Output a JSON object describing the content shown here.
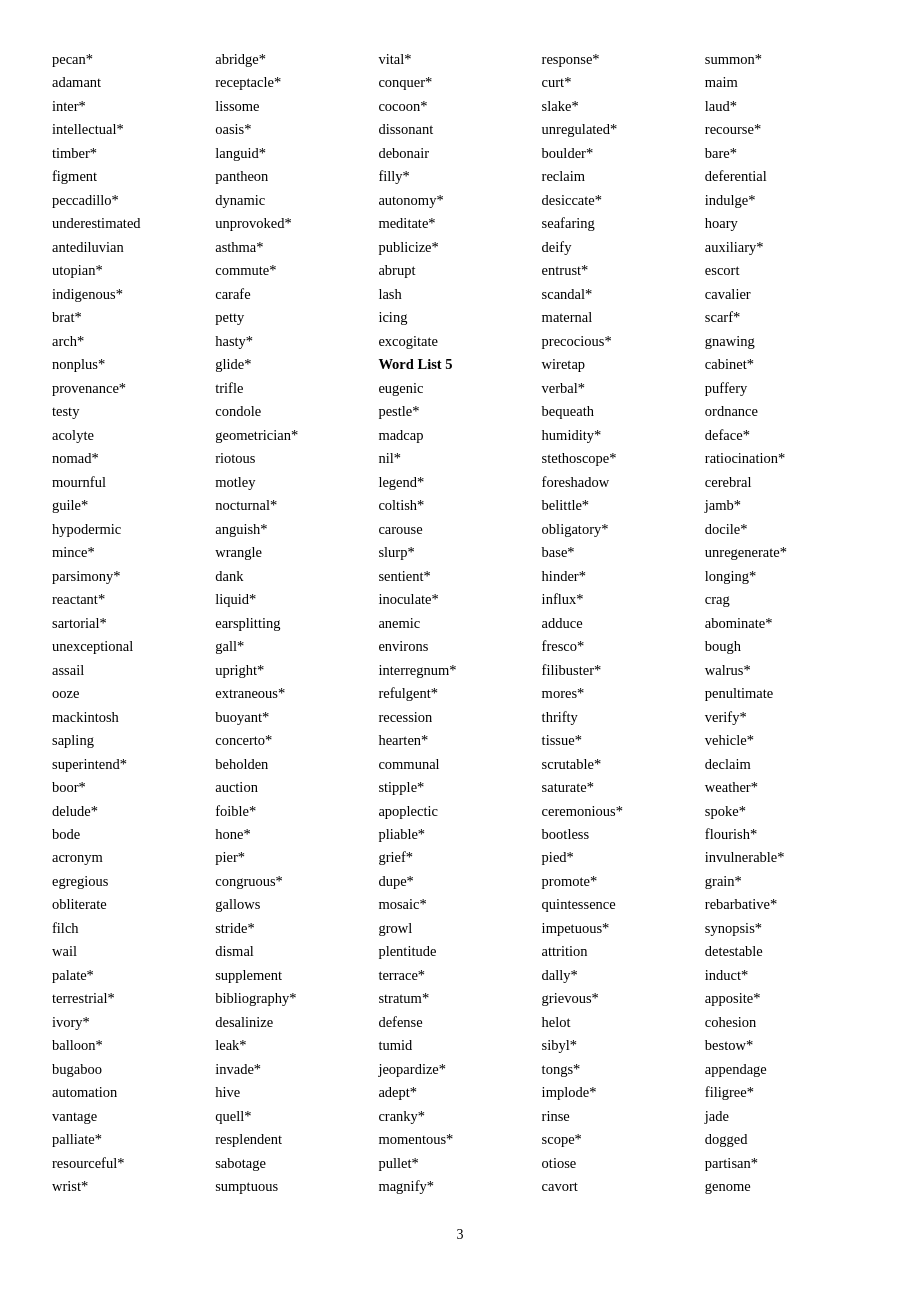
{
  "columns": [
    {
      "id": "col1",
      "words": [
        "pecan*",
        "adamant",
        "inter*",
        "intellectual*",
        "timber*",
        "figment",
        "peccadillo*",
        "underestimated",
        "antediluvian",
        "utopian*",
        "indigenous*",
        "brat*",
        "arch*",
        "nonplus*",
        "provenance*",
        "testy",
        "acolyte",
        "nomad*",
        "mournful",
        "guile*",
        "hypodermic",
        "mince*",
        "parsimony*",
        "reactant*",
        "sartorial*",
        "unexceptional",
        "assail",
        "ooze",
        "mackintosh",
        "sapling",
        "superintend*",
        "boor*",
        "delude*",
        "bode",
        "acronym",
        "egregious",
        "obliterate",
        "filch",
        "wail",
        "palate*",
        "terrestrial*",
        "ivory*",
        "balloon*",
        "bugaboo",
        "automation",
        "vantage",
        "palliate*",
        "resourceful*",
        "wrist*"
      ]
    },
    {
      "id": "col2",
      "words": [
        "abridge*",
        "receptacle*",
        "lissome",
        "oasis*",
        "languid*",
        "pantheon",
        "dynamic",
        "unprovoked*",
        "asthma*",
        "commute*",
        "carafe",
        "petty",
        "hasty*",
        "glide*",
        "trifle",
        "condole",
        "geometrician*",
        "riotous",
        "motley",
        "nocturnal*",
        "anguish*",
        "wrangle",
        "dank",
        "liquid*",
        "earsplitting",
        "gall*",
        "upright*",
        "extraneous*",
        "buoyant*",
        "concerto*",
        "beholden",
        "auction",
        "foible*",
        "hone*",
        "pier*",
        "congruous*",
        "gallows",
        "stride*",
        "dismal",
        "supplement",
        "bibliography*",
        "desalinize",
        "leak*",
        "invade*",
        "hive",
        "quell*",
        "resplendent",
        "sabotage",
        "sumptuous"
      ]
    },
    {
      "id": "col3",
      "words": [
        "vital*",
        "conquer*",
        "cocoon*",
        "dissonant",
        "debonair",
        "filly*",
        "autonomy*",
        "meditate*",
        "publicize*",
        "abrupt",
        "lash",
        "icing",
        "excogitate",
        "Word List 5",
        "eugenic",
        "pestle*",
        "madcap",
        "nil*",
        "legend*",
        "coltish*",
        "carouse",
        "slurp*",
        "sentient*",
        "inoculate*",
        "anemic",
        "environs",
        "interregnum*",
        "refulgent*",
        "recession",
        "hearten*",
        "communal",
        "stipple*",
        "apoplectic",
        "pliable*",
        "grief*",
        "dupe*",
        "mosaic*",
        "growl",
        "plentitude",
        "terrace*",
        "stratum*",
        "defense",
        "tumid",
        "jeopardize*",
        "adept*",
        "cranky*",
        "momentous*",
        "pullet*",
        "magnify*"
      ]
    },
    {
      "id": "col4",
      "words": [
        "response*",
        "curt*",
        "slake*",
        "unregulated*",
        "boulder*",
        "reclaim",
        "desiccate*",
        "seafaring",
        "deify",
        "entrust*",
        "scandal*",
        "maternal",
        "precocious*",
        "wiretap",
        "verbal*",
        "bequeath",
        "humidity*",
        "stethoscope*",
        "foreshadow",
        "belittle*",
        "obligatory*",
        "base*",
        "hinder*",
        "influx*",
        "adduce",
        "fresco*",
        "filibuster*",
        "mores*",
        "thrifty",
        "tissue*",
        "scrutable*",
        "saturate*",
        "ceremonious*",
        "bootless",
        "pied*",
        "promote*",
        "quintessence",
        "impetuous*",
        "attrition",
        "dally*",
        "grievous*",
        "helot",
        "sibyl*",
        "tongs*",
        "implode*",
        "rinse",
        "scope*",
        "otiose",
        "cavort"
      ]
    },
    {
      "id": "col5",
      "words": [
        "summon*",
        "maim",
        "laud*",
        "recourse*",
        "bare*",
        "deferential",
        "indulge*",
        "hoary",
        "auxiliary*",
        "escort",
        "cavalier",
        "scarf*",
        "gnawing",
        "cabinet*",
        "puffery",
        "ordnance",
        "deface*",
        "ratiocination*",
        "cerebral",
        "jamb*",
        "docile*",
        "unregenerate*",
        "longing*",
        "crag",
        "abominate*",
        "bough",
        "walrus*",
        "penultimate",
        "verify*",
        "vehicle*",
        "declaim",
        "weather*",
        "spoke*",
        "flourish*",
        "invulnerable*",
        "grain*",
        "rebarbative*",
        "synopsis*",
        "detestable",
        "induct*",
        "apposite*",
        "cohesion",
        "bestow*",
        "appendage",
        "filigree*",
        "jade",
        "dogged",
        "partisan*",
        "genome"
      ]
    }
  ],
  "page_number": "3"
}
